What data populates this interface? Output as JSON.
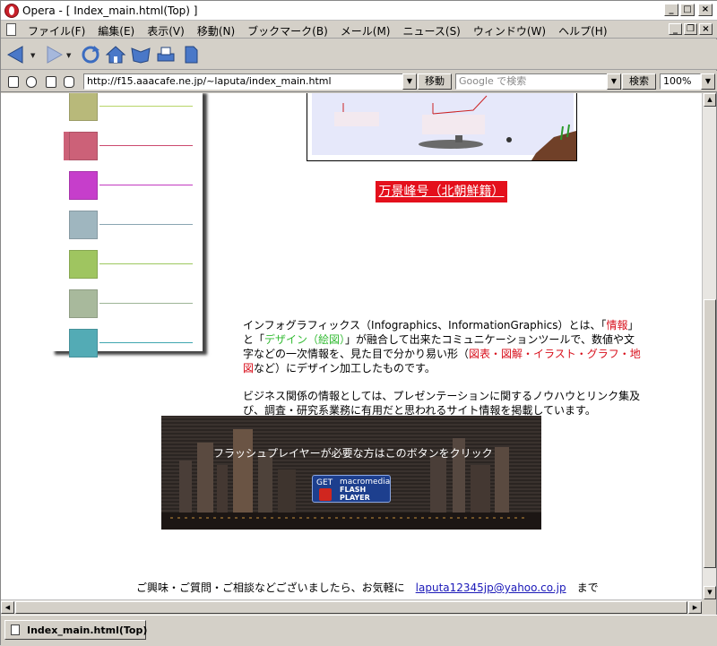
{
  "window": {
    "title": "Opera - [ Index_main.html(Top) ]"
  },
  "menu": {
    "items": [
      "ファイル(F)",
      "編集(E)",
      "表示(V)",
      "移動(N)",
      "ブックマーク(B)",
      "メール(M)",
      "ニュース(S)",
      "ウィンドウ(W)",
      "ヘルプ(H)"
    ]
  },
  "address": {
    "url": "http://f15.aaacafe.ne.jp/~laputa/index_main.html",
    "go_label": "移動",
    "search_placeholder": "Google で検索",
    "search_label": "検索",
    "zoom": "100%"
  },
  "page": {
    "nav_items": [
      {
        "name": "nav-olive",
        "color": "#b8b97a",
        "line": "#b8d468"
      },
      {
        "name": "nav-rose",
        "color": "#cc6178",
        "line": "#cc4a6e"
      },
      {
        "name": "nav-magenta",
        "color": "#c63ecb",
        "line": "#c23ac0"
      },
      {
        "name": "nav-bluegray",
        "color": "#9fb6bf",
        "line": "#8aa5b2"
      },
      {
        "name": "nav-green",
        "color": "#9fc560",
        "line": "#9cc85e"
      },
      {
        "name": "nav-sage",
        "color": "#a8b99c",
        "line": "#9db596"
      },
      {
        "name": "nav-teal",
        "color": "#53abb5",
        "line": "#3fa6b0"
      }
    ],
    "red_link": "万景峰号（北朝鮮籍）",
    "intro": {
      "t1": "インフォグラフィックス（Infographics、InformationGraphics）とは、「",
      "t2": "情報",
      "t3": "」と「",
      "t4": "デザイン（絵図）",
      "t5": "」が融合して出来たコミュニケーションツールで、数値や文字などの一次情報を、見た目で分かり易い形（",
      "t6": "図表・図解・イラスト・グラフ・地図",
      "t7": "など）にデザイン加工したものです。"
    },
    "business": "ビジネス関係の情報としては、プレゼンテーションに関するノウハウとリンク集及び、調査・研究系業務に有用だと思われるサイト情報を掲載しています。",
    "flash": {
      "caption": "フラッシュプレイヤーが必要な方はこのボタンをクリック",
      "btn_get": "GET",
      "btn_mm": "macromedia",
      "btn_flash": "FLASH",
      "btn_player": "PLAYER"
    },
    "footer": {
      "before": "ご興味・ご質問・ご相談などございましたら、お気軽に　",
      "email": "laputa12345jp@yahoo.co.jp",
      "after": "　まで"
    }
  },
  "status": {
    "tab_label": "Index_main.html(Top)"
  }
}
